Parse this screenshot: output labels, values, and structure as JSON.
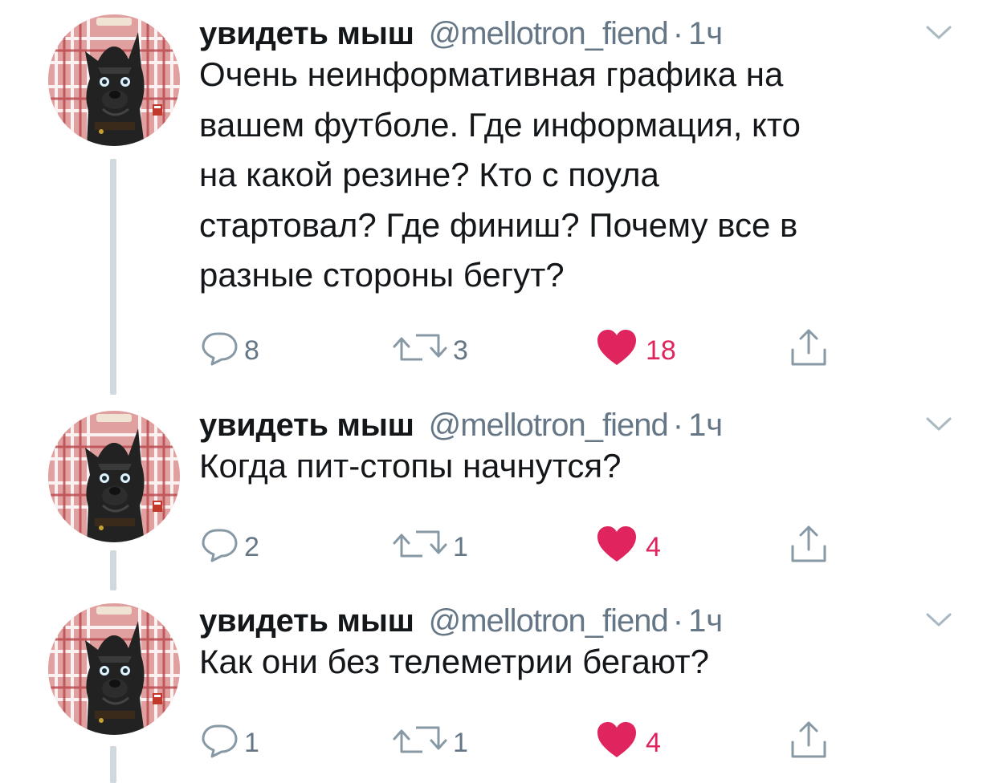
{
  "colors": {
    "name": "#14171a",
    "secondary": "#657786",
    "like": "#e0245e",
    "thread_line": "#cfd9de"
  },
  "icons": {
    "avatar": "avatar-dog",
    "caret": "chevron-down-icon",
    "reply": "reply-icon",
    "retweet": "retweet-icon",
    "like": "heart-icon",
    "share": "share-icon"
  },
  "tweets": [
    {
      "display_name": "увидеть мыш",
      "handle": "@mellotron_fiend",
      "separator": "·",
      "time": "1ч",
      "text": "Очень неинформативная графика на\nвашем футболе. Где информация, кто\nна какой резине? Кто с поула\nстартовал? Где финиш? Почему все в\nразные стороны бегут?",
      "replies": "8",
      "retweets": "3",
      "likes": "18",
      "liked": true
    },
    {
      "display_name": "увидеть мыш",
      "handle": "@mellotron_fiend",
      "separator": "·",
      "time": "1ч",
      "text": "Когда пит-стопы начнутся?",
      "replies": "2",
      "retweets": "1",
      "likes": "4",
      "liked": true
    },
    {
      "display_name": "увидеть мыш",
      "handle": "@mellotron_fiend",
      "separator": "·",
      "time": "1ч",
      "text": "Как они без телеметрии бегают?",
      "replies": "1",
      "retweets": "1",
      "likes": "4",
      "liked": true
    }
  ]
}
